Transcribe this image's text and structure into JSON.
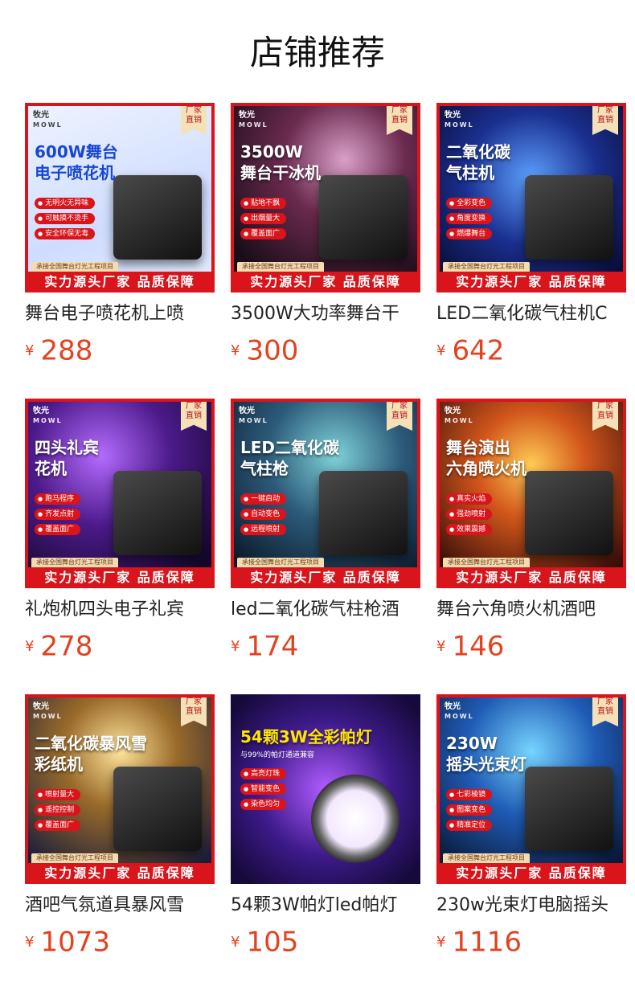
{
  "page": {
    "title": "店铺推荐"
  },
  "common": {
    "brand": "牧光",
    "brand_sub": "MOWL",
    "badge_top": "厂家",
    "badge_bottom": "直销",
    "banner_sub": "承接全国舞台灯光工程项目",
    "banner": "实力源头厂家 品质保障",
    "currency": "¥"
  },
  "products": [
    {
      "name": "舞台电子喷花机上喷",
      "price": "288",
      "headline": [
        "600W舞台",
        "电子喷花机"
      ],
      "features": [
        "无明火无异味",
        "可触摸不烫手",
        "安全环保无毒"
      ],
      "style": "light"
    },
    {
      "name": "3500W大功率舞台干",
      "price": "300",
      "headline": [
        "3500W",
        "舞台干冰机"
      ],
      "features": [
        "贴地不飘",
        "出烟量大",
        "覆盖面广"
      ],
      "style": "dark"
    },
    {
      "name": "LED二氧化碳气柱机C",
      "price": "642",
      "headline": [
        "二氧化碳",
        "气柱机"
      ],
      "features": [
        "全彩变色",
        "角度变换",
        "燃爆舞台"
      ],
      "style": "blue"
    },
    {
      "name": "礼炮机四头电子礼宾",
      "price": "278",
      "headline": [
        "四头礼宾",
        "花机"
      ],
      "features": [
        "跑马程序",
        "齐发点射",
        "覆盖面广"
      ],
      "style": "purple"
    },
    {
      "name": "led二氧化碳气柱枪酒",
      "price": "174",
      "headline": [
        "LED二氧化碳",
        "气柱枪"
      ],
      "features": [
        "一键启动",
        "自动变色",
        "远程喷射"
      ],
      "style": "teal"
    },
    {
      "name": "舞台六角喷火机酒吧",
      "price": "146",
      "headline": [
        "舞台演出",
        "六角喷火机"
      ],
      "features": [
        "真实火焰",
        "强劲喷射",
        "效果震撼"
      ],
      "style": "fire"
    },
    {
      "name": "酒吧气氛道具暴风雪",
      "price": "1073",
      "headline": [
        "二氧化碳暴风雪",
        "彩纸机"
      ],
      "features": [
        "喷射量大",
        "遥控控制",
        "覆盖面广"
      ],
      "style": "gold"
    },
    {
      "name": "54颗3W帕灯led帕灯",
      "price": "105",
      "headline": [
        "54颗3W全彩帕灯"
      ],
      "tagline": "与99%的帕灯通道兼容",
      "features": [
        "高亮灯珠",
        "智能变色",
        "染色均匀"
      ],
      "style": "par"
    },
    {
      "name": "230w光束灯电脑摇头",
      "price": "1116",
      "headline": [
        "230W",
        "摇头光束灯"
      ],
      "features": [
        "七彩棱镜",
        "图案变色",
        "精准定位"
      ],
      "style": "beam"
    }
  ]
}
